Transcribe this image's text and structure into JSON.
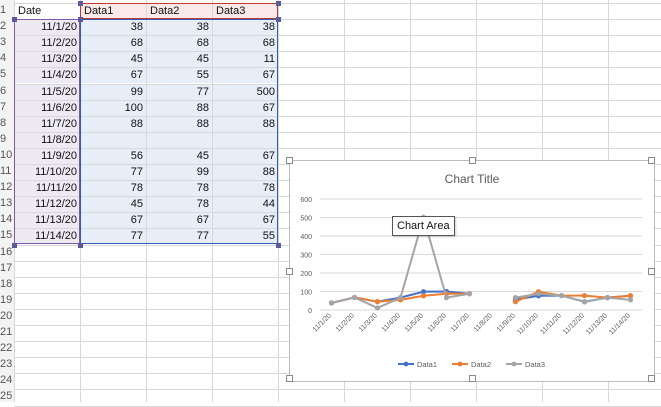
{
  "sheet": {
    "headers": [
      "Date",
      "Data1",
      "Data2",
      "Data3"
    ],
    "row_numbers": [
      "1",
      "2",
      "3",
      "4",
      "5",
      "6",
      "7",
      "8",
      "9",
      "10",
      "11",
      "12",
      "13",
      "14",
      "15",
      "16",
      "17",
      "18",
      "19",
      "20",
      "21",
      "22",
      "23",
      "24",
      "25"
    ],
    "rows": [
      [
        "11/1/20",
        "38",
        "38",
        "38"
      ],
      [
        "11/2/20",
        "68",
        "68",
        "68"
      ],
      [
        "11/3/20",
        "45",
        "45",
        "11"
      ],
      [
        "11/4/20",
        "67",
        "55",
        "67"
      ],
      [
        "11/5/20",
        "99",
        "77",
        "500"
      ],
      [
        "11/6/20",
        "100",
        "88",
        "67"
      ],
      [
        "11/7/20",
        "88",
        "88",
        "88"
      ],
      [
        "11/8/20",
        "",
        "",
        ""
      ],
      [
        "11/9/20",
        "56",
        "45",
        "67"
      ],
      [
        "11/10/20",
        "77",
        "99",
        "88"
      ],
      [
        "11/11/20",
        "78",
        "78",
        "78"
      ],
      [
        "11/12/20",
        "45",
        "78",
        "44"
      ],
      [
        "11/13/20",
        "67",
        "67",
        "67"
      ],
      [
        "11/14/20",
        "77",
        "77",
        "55"
      ]
    ]
  },
  "tooltip": "Chart Area",
  "chart_data": {
    "type": "line",
    "title": "Chart Title",
    "categories": [
      "11/1/20",
      "11/2/20",
      "11/3/20",
      "11/4/20",
      "11/5/20",
      "11/6/20",
      "11/7/20",
      "11/8/20",
      "11/9/20",
      "11/10/20",
      "11/11/20",
      "11/12/20",
      "11/13/20",
      "11/14/20"
    ],
    "series": [
      {
        "name": "Data1",
        "color": "#4472c4",
        "values": [
          38,
          68,
          45,
          67,
          99,
          100,
          88,
          null,
          56,
          77,
          78,
          45,
          67,
          77
        ]
      },
      {
        "name": "Data2",
        "color": "#ed7d31",
        "values": [
          38,
          68,
          45,
          55,
          77,
          88,
          88,
          null,
          45,
          99,
          78,
          78,
          67,
          77
        ]
      },
      {
        "name": "Data3",
        "color": "#a5a5a5",
        "values": [
          38,
          68,
          11,
          67,
          500,
          67,
          88,
          null,
          67,
          88,
          78,
          44,
          67,
          55
        ]
      }
    ],
    "ylim": [
      0,
      600
    ],
    "yticks": [
      "0",
      "100",
      "200",
      "300",
      "400",
      "500",
      "600"
    ],
    "grid": true,
    "legend": "bottom"
  }
}
